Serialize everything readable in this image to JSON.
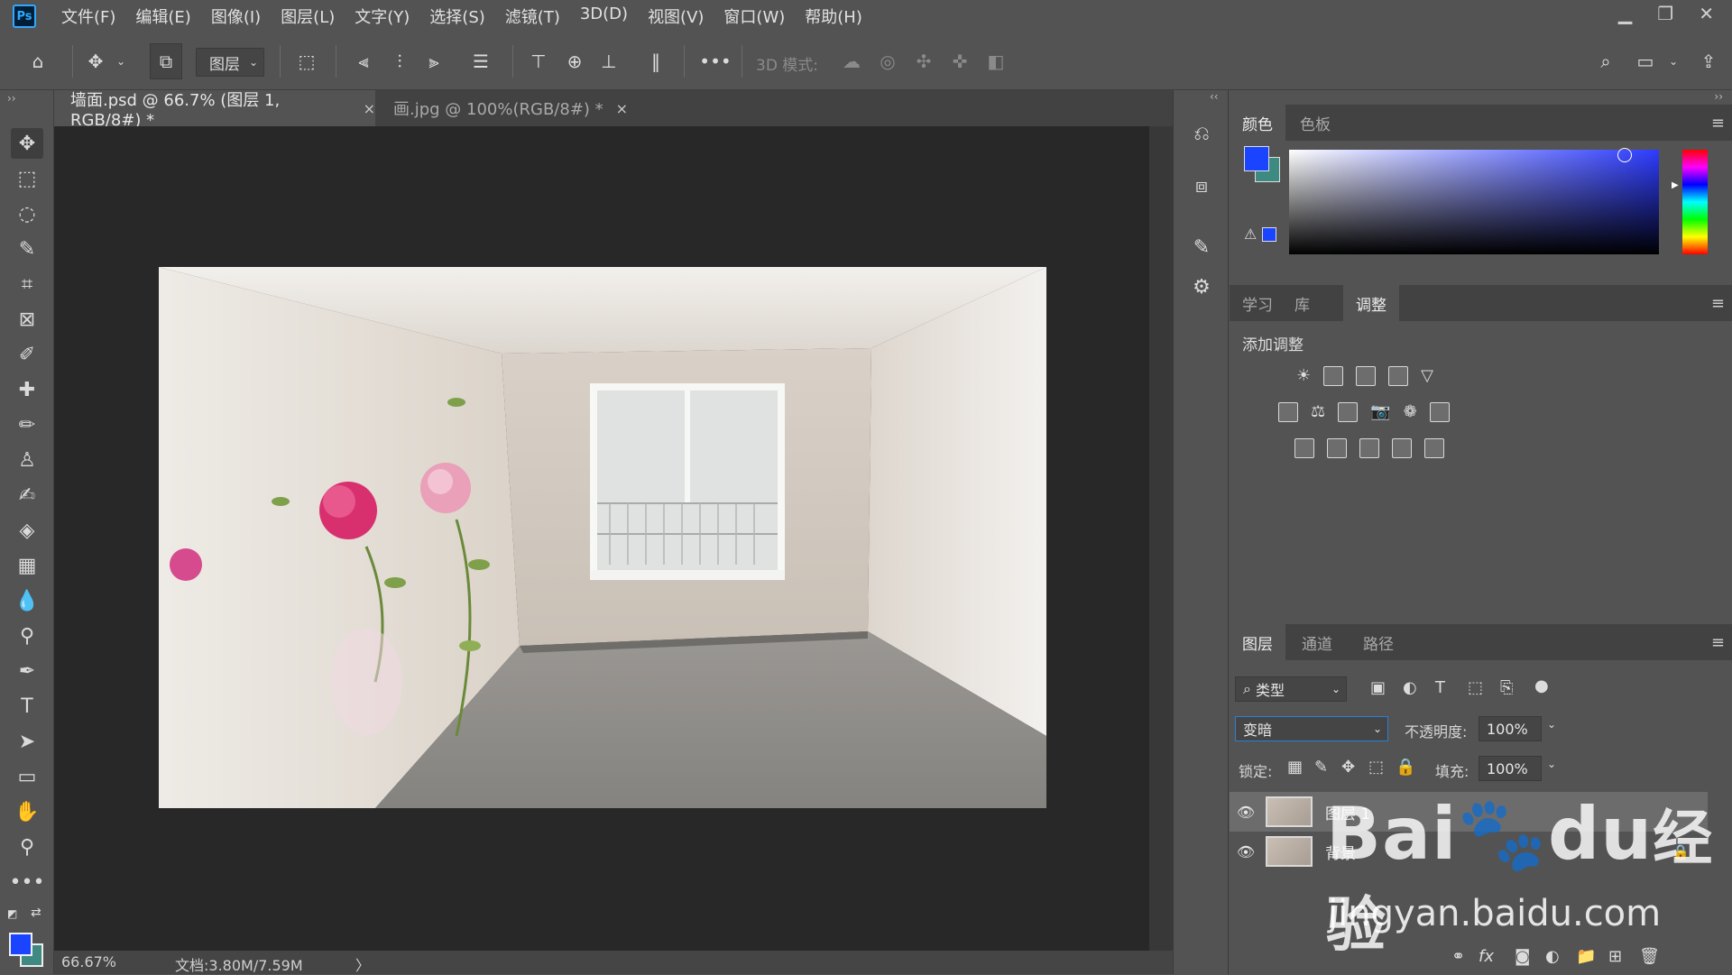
{
  "app": {
    "logo": "Ps"
  },
  "menu": [
    "文件(F)",
    "编辑(E)",
    "图像(I)",
    "图层(L)",
    "文字(Y)",
    "选择(S)",
    "滤镜(T)",
    "3D(D)",
    "视图(V)",
    "窗口(W)",
    "帮助(H)"
  ],
  "options": {
    "target_select": "图层",
    "mode_3d_label": "3D 模式:",
    "more": "•••"
  },
  "tabs": [
    {
      "label": "墙面.psd @ 66.7% (图层 1, RGB/8#) *",
      "close": "×"
    },
    {
      "label": "画.jpg @ 100%(RGB/8#) *",
      "close": "×"
    }
  ],
  "status": {
    "zoom": "66.67%",
    "doc": "文档:3.80M/7.59M",
    "arrow": "〉"
  },
  "color_panel": {
    "tabs": [
      "颜色",
      "色板"
    ],
    "fg": "#1a44ff",
    "bg": "#3f8a80"
  },
  "adjust_panel": {
    "tabs": [
      "学习",
      "库",
      "调整"
    ],
    "title": "添加调整"
  },
  "layers_panel": {
    "tabs": [
      "图层",
      "通道",
      "路径"
    ],
    "filter_kind": "类型",
    "blend_mode": "变暗",
    "opacity_label": "不透明度:",
    "opacity_value": "100%",
    "lock_label": "锁定:",
    "fill_label": "填充:",
    "fill_value": "100%",
    "layers": [
      {
        "name": "图层 1",
        "selected": true
      },
      {
        "name": "背景",
        "locked": true
      }
    ]
  },
  "watermark": {
    "brand": "Bai",
    "brand2": "du",
    "suffix": "经验",
    "url": "jingyan.baidu.com"
  }
}
